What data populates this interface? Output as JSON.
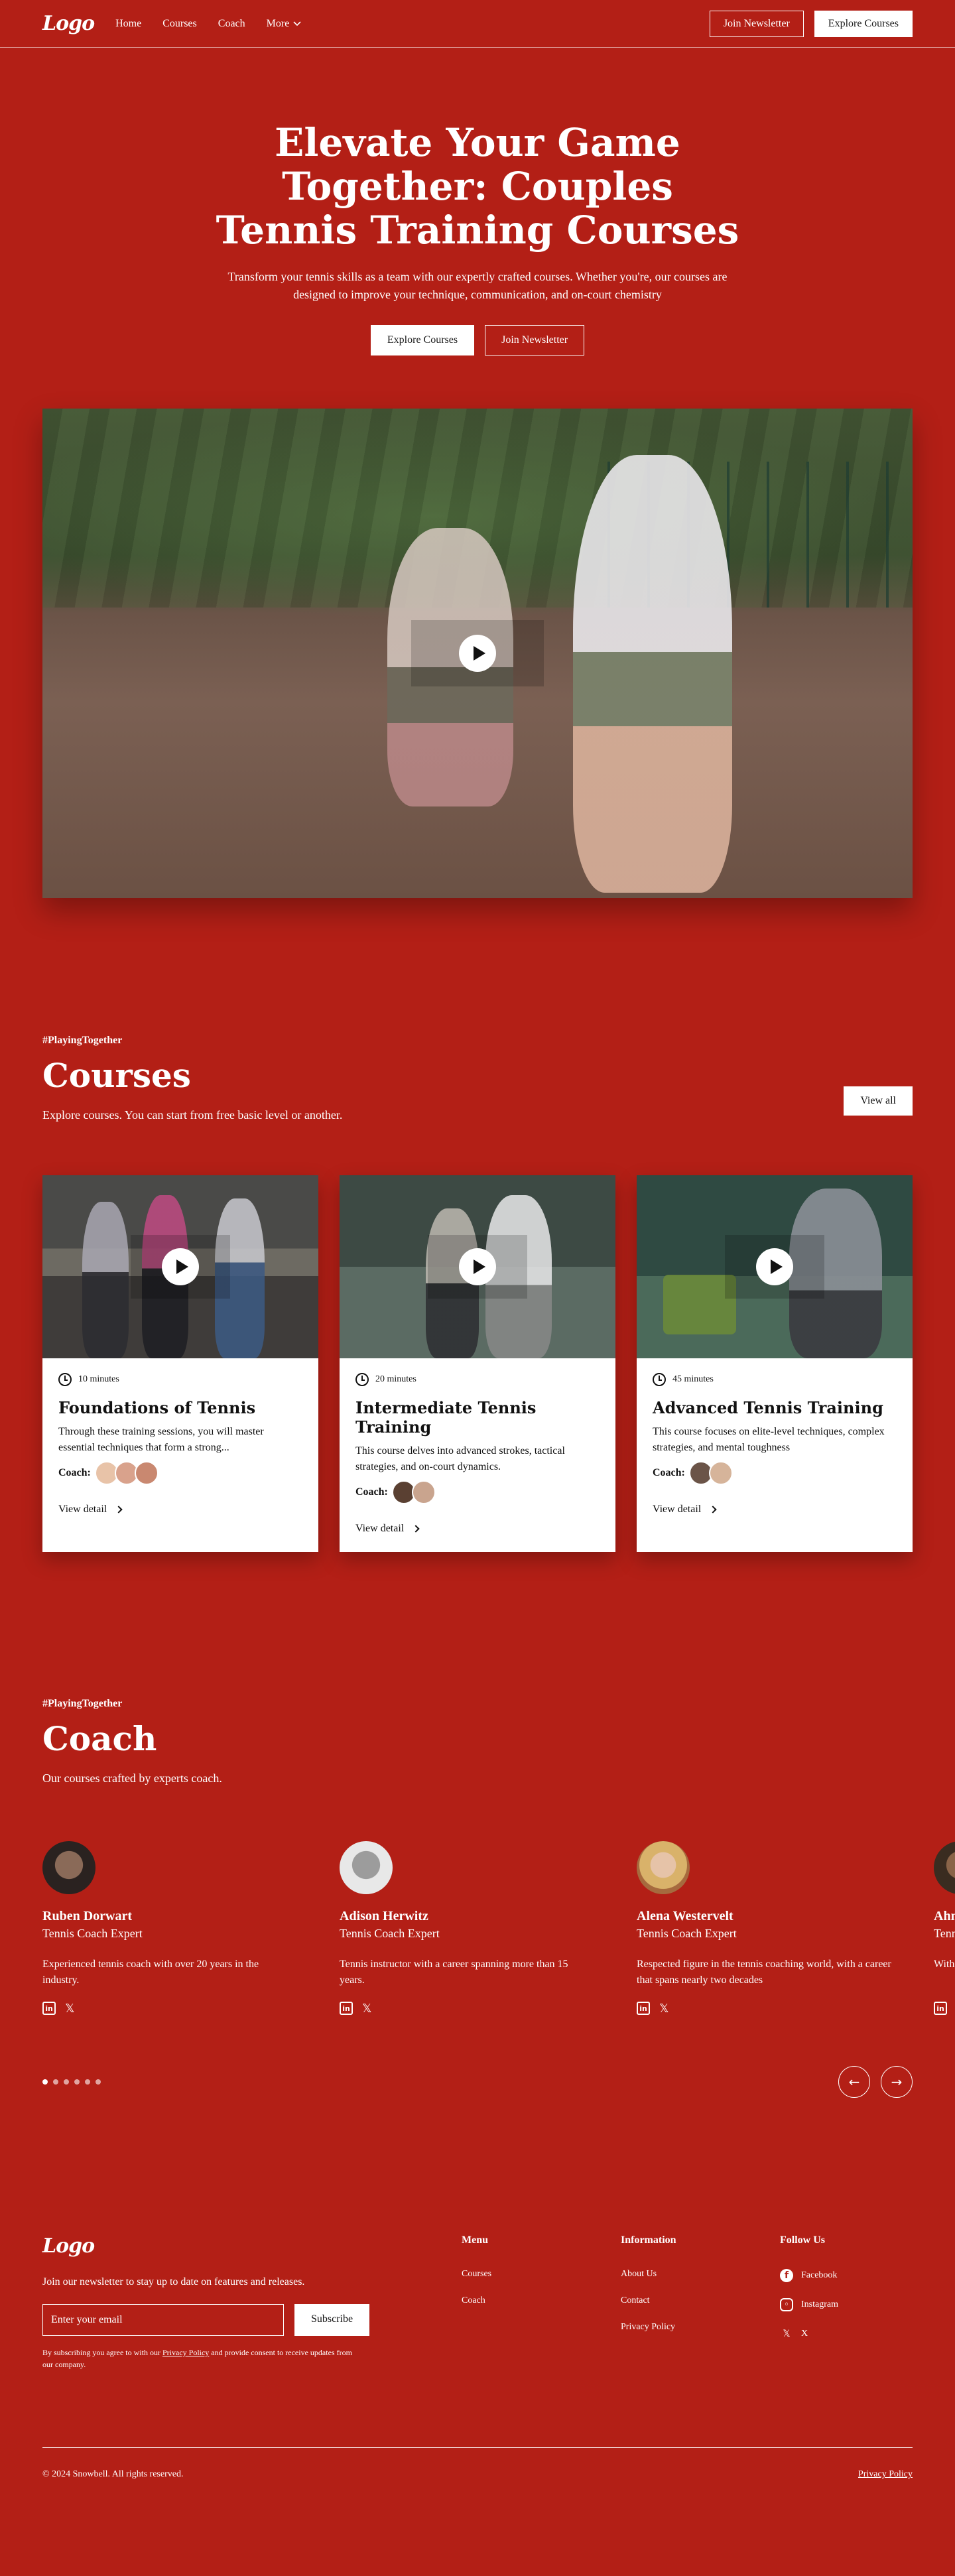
{
  "nav": {
    "logo": "Logo",
    "links": [
      "Home",
      "Courses",
      "Coach",
      "More"
    ],
    "join_label": "Join Newsletter",
    "explore_label": "Explore Courses"
  },
  "hero": {
    "title": "Elevate Your Game Together: Couples Tennis Training Courses",
    "description": "Transform your tennis skills as a team with our expertly crafted courses. Whether you're, our courses are designed to improve your technique, communication, and on-court chemistry",
    "explore_label": "Explore Courses",
    "join_label": "Join Newsletter"
  },
  "courses": {
    "tagline": "#PlayingTogether",
    "title": "Courses",
    "description": "Explore courses. You can start from free basic level or another.",
    "view_all_label": "View all",
    "coach_label": "Coach:",
    "detail_label": "View detail",
    "items": [
      {
        "duration": "10 minutes",
        "title": "Foundations of Tennis",
        "description": "Through these training sessions, you will master essential techniques that form a strong..."
      },
      {
        "duration": "20 minutes",
        "title": "Intermediate Tennis Training",
        "description": "This course delves into advanced strokes, tactical strategies, and on-court dynamics."
      },
      {
        "duration": "45 minutes",
        "title": "Advanced Tennis Training",
        "description": "This course focuses on elite-level techniques, complex strategies, and mental toughness"
      }
    ]
  },
  "coach": {
    "tagline": "#PlayingTogether",
    "title": "Coach",
    "description": "Our courses crafted by experts coach.",
    "items": [
      {
        "name": "Ruben Dorwart",
        "role": "Tennis Coach Expert",
        "bio": "Experienced tennis coach with over 20 years in the industry."
      },
      {
        "name": "Adison Herwitz",
        "role": "Tennis Coach Expert",
        "bio": "Tennis instructor with a career spanning more than 15 years."
      },
      {
        "name": "Alena Westervelt",
        "role": "Tennis Coach Expert",
        "bio": "Respected figure in the tennis coaching world, with a career that spans nearly two decades"
      },
      {
        "name": "Ahmad Saris",
        "role": "Tennis Coach Expert",
        "bio": "With a wealth of training knowledge"
      }
    ],
    "social_linkedin": "in",
    "social_x": "𝕏",
    "prev_arrow": "←",
    "next_arrow": "→"
  },
  "footer": {
    "logo": "Logo",
    "newsletter_text": "Join our newsletter to stay up to date on features and releases.",
    "email_placeholder": "Enter your email",
    "subscribe_label": "Subscribe",
    "legal_prefix": "By subscribing you agree to with our ",
    "legal_link": "Privacy Policy",
    "legal_suffix": " and provide consent to receive updates from our company.",
    "menu_title": "Menu",
    "menu_links": [
      "Courses",
      "Coach"
    ],
    "info_title": "Information",
    "info_links": [
      "About Us",
      "Contact",
      "Privacy Policy"
    ],
    "follow_title": "Follow Us",
    "follow_links": [
      "Facebook",
      "Instagram",
      "X"
    ],
    "copyright": "© 2024 Snowbell. All rights reserved.",
    "privacy_label": "Privacy Policy"
  }
}
